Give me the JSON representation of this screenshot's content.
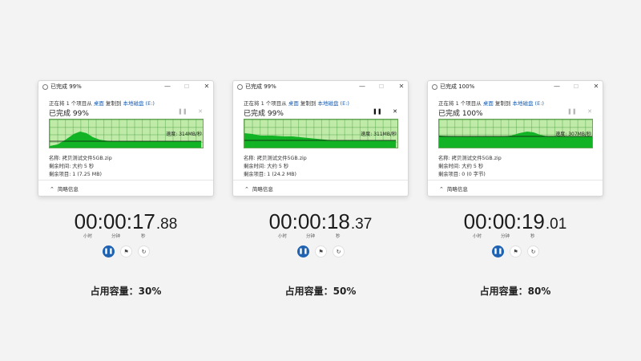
{
  "panels": [
    {
      "title": "已完成 99%",
      "status": {
        "prefix": "正在将 1 个项目从 ",
        "src": "桌面",
        "mid": " 复制到 ",
        "dst": "本地磁盘 (E:)"
      },
      "percent_label": "已完成 99%",
      "progress": 0.99,
      "controls_active": false,
      "speed_label": "速度: 314MB/秒",
      "name_label": "名称: 拷贝测试文件5GB.zip",
      "time_label": "剩余时间: 大约 5 秒",
      "items_label": "剩余项目: 1 (7.25 MB)",
      "details_label": "简略信息",
      "timer": {
        "main": "00:00:17",
        "ms": ".88"
      },
      "units": {
        "h": "小时",
        "m": "分钟",
        "s": "秒"
      },
      "caption": "占用容量：30%"
    },
    {
      "title": "已完成 99%",
      "status": {
        "prefix": "正在将 1 个项目从 ",
        "src": "桌面",
        "mid": " 复制到 ",
        "dst": "本地磁盘 (E:)"
      },
      "percent_label": "已完成 99%",
      "progress": 0.99,
      "controls_active": true,
      "speed_label": "速度: 311MB/秒",
      "name_label": "名称: 拷贝测试文件5GB.zip",
      "time_label": "剩余时间: 大约 5 秒",
      "items_label": "剩余项目: 1 (24.2 MB)",
      "details_label": "简略信息",
      "timer": {
        "main": "00:00:18",
        "ms": ".37"
      },
      "units": {
        "h": "小时",
        "m": "分钟",
        "s": "秒"
      },
      "caption": "占用容量：50%"
    },
    {
      "title": "已完成 100%",
      "status": {
        "prefix": "正在将 1 个项目从 ",
        "src": "桌面",
        "mid": " 复制到 ",
        "dst": "本地磁盘 (E:)"
      },
      "percent_label": "已完成 100%",
      "progress": 1.0,
      "controls_active": false,
      "speed_label": "速度: 307MB/秒",
      "name_label": "名称: 拷贝测试文件5GB.zip",
      "time_label": "剩余时间: 大约 5 秒",
      "items_label": "剩余项目: 0 (0 字节)",
      "details_label": "简略信息",
      "timer": {
        "main": "00:00:19",
        "ms": ".01"
      },
      "units": {
        "h": "小时",
        "m": "分钟",
        "s": "秒"
      },
      "caption": "占用容量：80%"
    }
  ],
  "icons": {
    "minimize": "minimize-icon",
    "maximize": "maximize-icon",
    "close": "close-icon",
    "pause": "pause-icon",
    "cancel": "cancel-icon",
    "chevron": "chevron-up-icon",
    "lap": "flag-icon",
    "reset": "reset-icon"
  },
  "colors": {
    "graph_bg": "#bfeaa8",
    "graph_fill": "#12b324",
    "link": "#1a5fb4",
    "stopwatch_accent": "#1f62b2",
    "background": "#f3f3f3"
  }
}
